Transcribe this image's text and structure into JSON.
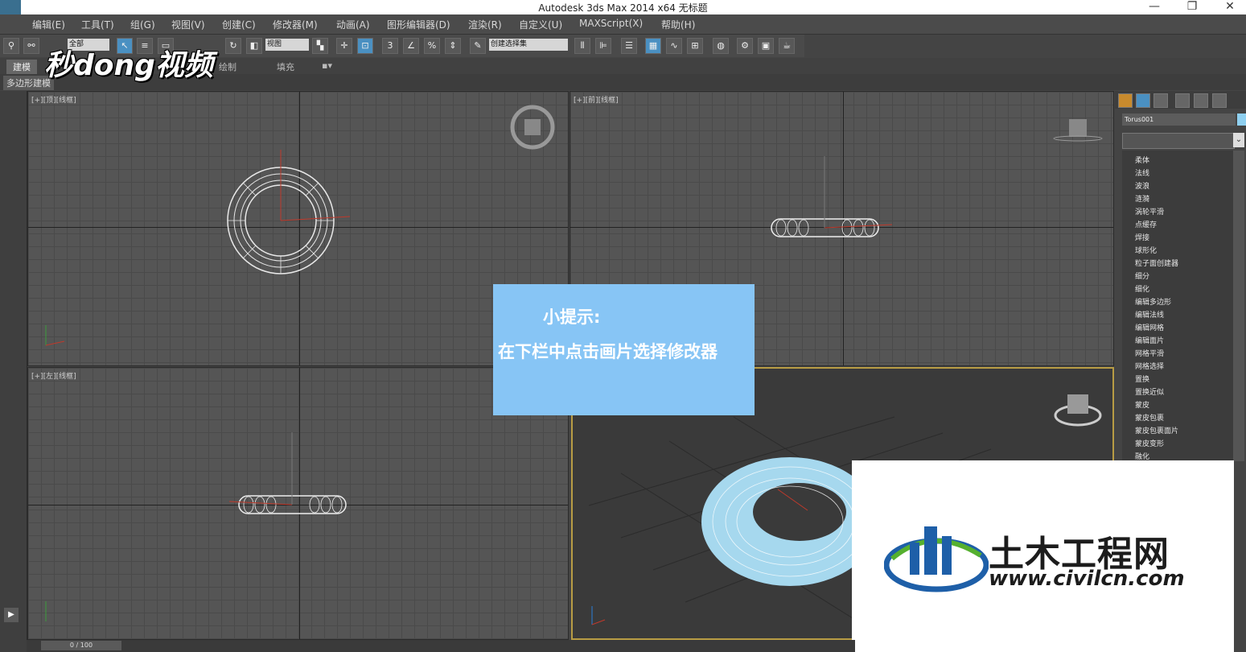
{
  "window": {
    "title": "Autodesk 3ds Max  2014 x64    无标题",
    "controls": {
      "minimize": "—",
      "restore": "❐",
      "close": "✕"
    }
  },
  "menu": [
    "编辑(E)",
    "工具(T)",
    "组(G)",
    "视图(V)",
    "创建(C)",
    "修改器(M)",
    "动画(A)",
    "图形编辑器(D)",
    "渲染(R)",
    "自定义(U)",
    "MAXScript(X)",
    "帮助(H)"
  ],
  "toolbar": {
    "select_filter": "全部",
    "ref_coord": "视图",
    "named_selection": "创建选择集",
    "snap_label": "3",
    "percent_snap": "%"
  },
  "ribbon": {
    "tabs": [
      "建模",
      "绘制",
      "填充"
    ],
    "sub_label": "多边形建模"
  },
  "watermark": "秒dong视频",
  "viewports": {
    "top": "[+][顶][线框]",
    "front": "[+][前][线框]",
    "left": "[+][左][线框]"
  },
  "tip": {
    "title": "小提示:",
    "body": "在下栏中点击画片选择修改器"
  },
  "command_panel": {
    "object_name": "Torus001",
    "modifiers": [
      "柔体",
      "法线",
      "波浪",
      "涟漪",
      "涡轮平滑",
      "点缓存",
      "焊接",
      "球形化",
      "粒子面创建器",
      "细分",
      "细化",
      "编辑多边形",
      "编辑法线",
      "编辑网格",
      "编辑面片",
      "网格平滑",
      "网格选择",
      "置换",
      "置换近似",
      "蒙皮",
      "蒙皮包裹",
      "蒙皮包裹面片",
      "蒙皮变形",
      "融化"
    ]
  },
  "logo": {
    "text": "土木工程网",
    "url": "www.civilcn.com"
  },
  "timeline": {
    "frame": "0 / 100"
  }
}
